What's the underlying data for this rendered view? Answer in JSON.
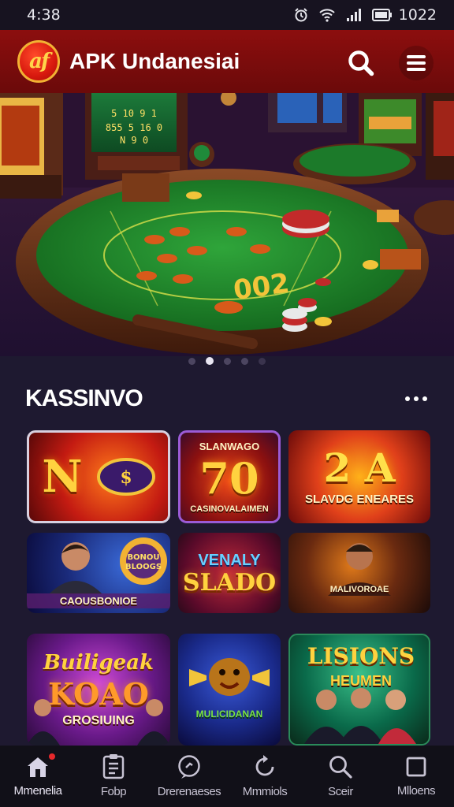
{
  "status_bar": {
    "time": "4:38",
    "clock": "1022"
  },
  "header": {
    "title": "APK Undanesiai",
    "logo_text": "af"
  },
  "carousel": {
    "slide_count": 4,
    "active_index": 1
  },
  "section": {
    "title": "KASSINVO"
  },
  "games": [
    {
      "id": "tile-1",
      "big": "N",
      "small": ""
    },
    {
      "id": "tile-2",
      "top": "SLANWAGO",
      "big": "70",
      "small": "CASINOVALAIMEN"
    },
    {
      "id": "tile-3",
      "big": "2 A",
      "small": "SLAVDG ENEARES"
    },
    {
      "id": "tile-4",
      "big": "",
      "small": "CAOUSBONIOE"
    },
    {
      "id": "tile-5",
      "top": "VENALY",
      "big": "SLADO",
      "small": ""
    },
    {
      "id": "tile-6",
      "big": "",
      "small": "MALIVOROAE"
    },
    {
      "id": "tile-7",
      "top": "Builigeak",
      "big": "KOAO",
      "small": "GROSIUING"
    },
    {
      "id": "tile-8",
      "big": "",
      "small": "MULICIDANAN"
    },
    {
      "id": "tile-9",
      "top": "LISIONS",
      "big": "",
      "small": "HEUMEN"
    }
  ],
  "bottom_nav": [
    {
      "label": "Mmenelia",
      "icon": "home-icon"
    },
    {
      "label": "Fobp",
      "icon": "clipboard-icon"
    },
    {
      "label": "Drerenaeses",
      "icon": "chat-icon"
    },
    {
      "label": "Mmmiols",
      "icon": "refresh-icon"
    },
    {
      "label": "Sceir",
      "icon": "search-icon"
    },
    {
      "label": "Mlloens",
      "icon": "square-icon"
    }
  ]
}
